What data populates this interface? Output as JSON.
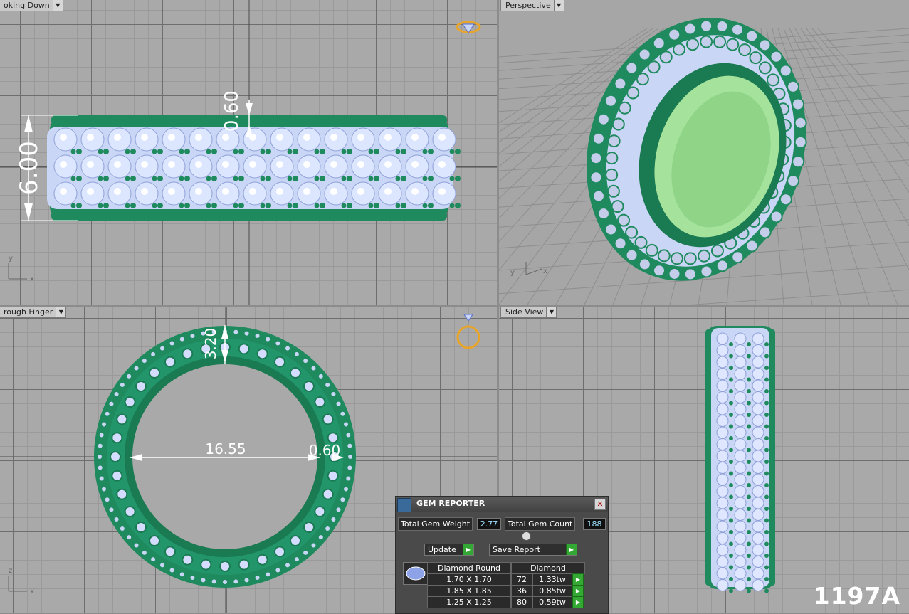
{
  "viewports": {
    "top_label": "oking Down",
    "perspective_label": "Perspective",
    "front_label": "rough Finger",
    "side_label": "Side View"
  },
  "dimensions": {
    "height": "6.00",
    "top_offset": "0.60",
    "wall": "3.20",
    "inner_diameter": "16.55",
    "side_offset": "0.60"
  },
  "axes": {
    "x": "x",
    "y": "y",
    "z": "z"
  },
  "watermark": "1197A",
  "gem_reporter": {
    "title": "GEM REPORTER",
    "total_weight_label": "Total Gem Weight",
    "total_weight": "2.77",
    "total_count_label": "Total Gem Count",
    "total_count": "188",
    "update_label": "Update",
    "save_label": "Save Report",
    "header_shape": "Diamond Round",
    "header_material": "Diamond",
    "rows": [
      {
        "size": "1.70 X 1.70",
        "count": "72",
        "weight": "1.33tw"
      },
      {
        "size": "1.85 X 1.85",
        "count": "36",
        "weight": "0.85tw"
      },
      {
        "size": "1.25 X 1.25",
        "count": "80",
        "weight": "0.59tw"
      }
    ]
  },
  "colors": {
    "metal": "#1f8a5e",
    "gem": "#c9d6f5",
    "background": "#a9a9a9"
  }
}
